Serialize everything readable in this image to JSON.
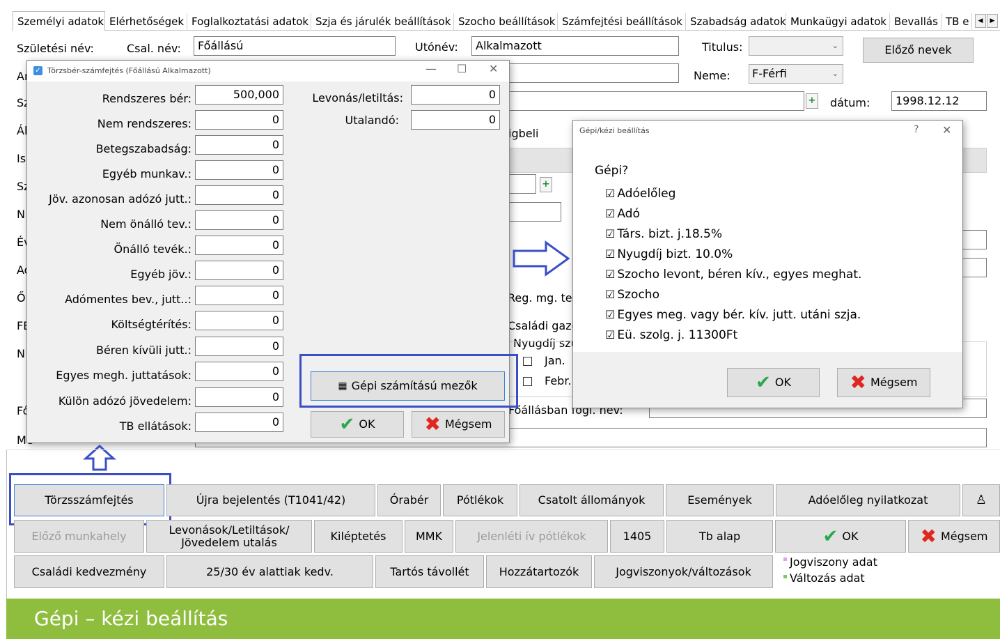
{
  "tabs": [
    "Személyi adatok",
    "Elérhetőségek",
    "Foglalkoztatási adatok",
    "Szja és járulék beállítások",
    "Szocho beállítások",
    "Számfejtési beállítások",
    "Szabadság adatok",
    "Munkaügyi adatok",
    "Bevallás",
    "TB e"
  ],
  "form": {
    "szuletesi_nev": "Születési név:",
    "csal_nev_label": "Csal. név:",
    "csal_nev_value": "Főállású",
    "utonev_label": "Utónév:",
    "utonev_value": "Alkalmazott",
    "titulus_label": "Titulus:",
    "elozo_nevek": "Előző nevek",
    "neme_label": "Neme:",
    "neme_value": "F-Férfi",
    "datum_label": "dátum:",
    "datum_value": "1998.12.12",
    "igbeli": "igbeli",
    "reg_mg": "Reg. mg. te",
    "csaladi_gazd": "Családi gazd",
    "nyugdij": "Nyugdíj szü",
    "jan": "Jan.",
    "febr": "Febr.",
    "foallasban": "Főállásban fogl. név:",
    "side_letters": [
      "Ar",
      "Sz",
      "Ál",
      "Is",
      "Sz",
      "N",
      "Év",
      "Ad",
      "Ő",
      "FE",
      "N",
      "Fő",
      "Me"
    ]
  },
  "torzsber": {
    "title": "Törzsbér-számfejtés (Főállású Alkalmazott)",
    "rows": [
      {
        "label": "Rendszeres bér:",
        "value": "500,000"
      },
      {
        "label": "Nem rendszeres:",
        "value": "0"
      },
      {
        "label": "Betegszabadság:",
        "value": "0"
      },
      {
        "label": "Egyéb munkav.:",
        "value": "0"
      },
      {
        "label": "Jöv. azonosan adózó jutt.:",
        "value": "0"
      },
      {
        "label": "Nem önálló tev.:",
        "value": "0"
      },
      {
        "label": "Önálló tevék.:",
        "value": "0"
      },
      {
        "label": "Egyéb jöv.:",
        "value": "0"
      },
      {
        "label": "Adómentes bev., jutt..:",
        "value": "0"
      },
      {
        "label": "Költségtérítés:",
        "value": "0"
      },
      {
        "label": "Béren kívüli jutt.:",
        "value": "0"
      },
      {
        "label": "Egyes megh. juttatások:",
        "value": "0"
      },
      {
        "label": "Külön adózó jövedelem:",
        "value": "0"
      },
      {
        "label": "TB ellátások:",
        "value": "0"
      }
    ],
    "levonas_label": "Levonás/letiltás:",
    "levonas_value": "0",
    "utalando_label": "Utalandó:",
    "utalando_value": "0",
    "gepi_btn": "Gépi számítású mezők",
    "ok": "OK",
    "megsem": "Mégsem"
  },
  "gepi": {
    "title": "Gépi/kézi beállítás",
    "help": "?",
    "heading": "Gépi?",
    "items": [
      "Adóelőleg",
      "Adó",
      "Társ. bizt. j.18.5%",
      "Nyugdíj bizt. 10.0%",
      "Szocho levont, béren kív., egyes meghat.",
      "Szocho",
      "Egyes meg. vagy bér. kív. jutt. utáni szja.",
      "Eü. szolg. j. 11300Ft"
    ],
    "ok": "OK",
    "megsem": "Mégsem"
  },
  "buttons": {
    "row1": [
      "Törzsszámfejtés",
      "Újra bejelentés (T1041/42)",
      "Órabér",
      "Pótlékok",
      "Csatolt állományok",
      "Események",
      "Adóelőleg nyilatkozat"
    ],
    "row2": [
      "Előző munkahely",
      "Levonások/Letiltások/",
      "Jövedelem utalás",
      "Kiléptetés",
      "MMK",
      "Jelenléti ív pótlékok",
      "1405",
      "Tb alap",
      "OK",
      "Mégsem"
    ],
    "row3": [
      "Családi kedvezmény",
      "25/30 év alattiak kedv.",
      "Tartós távollét",
      "Hozzátartozók",
      "Jogviszonyok/változások"
    ],
    "legend": [
      "Jogviszony adat",
      "Változás adat"
    ]
  },
  "banner": "Gépi – kézi beállítás",
  "colors": {
    "highlight": "#3a4fc7",
    "banner": "#8fbe3f",
    "ok_green": "#2aa84a",
    "cancel_red": "#e0261f"
  }
}
